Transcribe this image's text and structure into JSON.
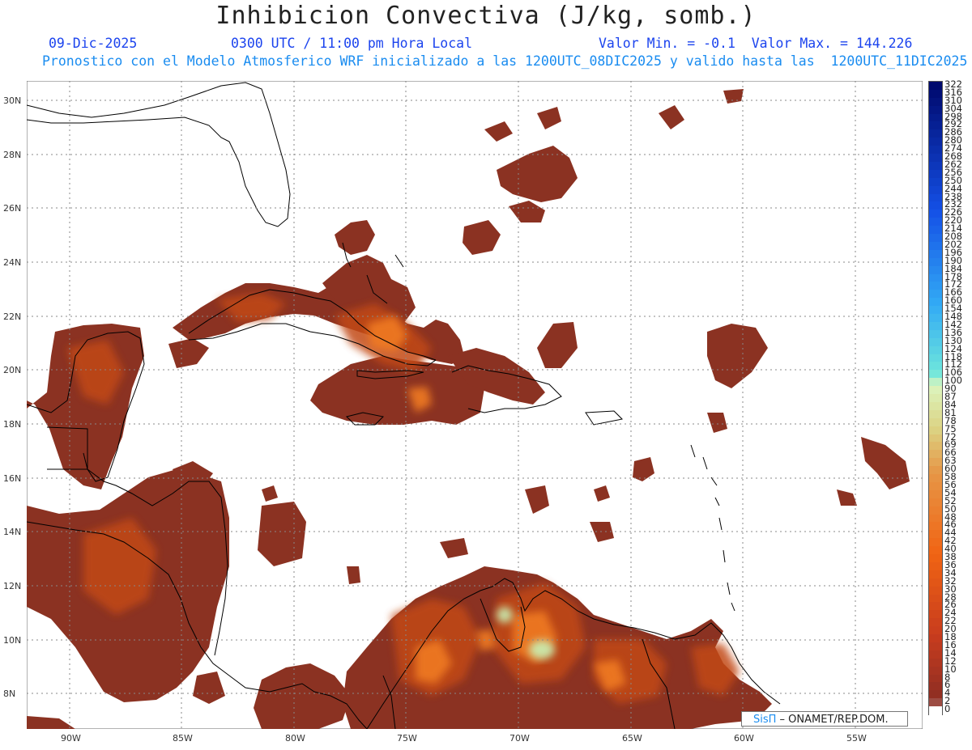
{
  "header": {
    "title": "Inhibicion Convectiva (J/kg, somb.)",
    "date": "09-Dic-2025",
    "time": "0300 UTC / 11:00 pm Hora Local",
    "value_range": "Valor Min. = -0.1  Valor Max. = 144.226",
    "model_info": "Pronostico con el Modelo Atmosferico WRF inicializado a las 1200UTC_08DIC2025 y valido hasta las  1200UTC_11DIC2025"
  },
  "map": {
    "lat_labels": [
      "30N",
      "28N",
      "26N",
      "24N",
      "22N",
      "20N",
      "18N",
      "16N",
      "14N",
      "12N",
      "10N",
      "8N"
    ],
    "lon_labels": [
      "90W",
      "85W",
      "80W",
      "75W",
      "70W",
      "65W",
      "60W",
      "55W"
    ],
    "colors": {
      "cin_low": "#8b3222",
      "cin_mid": "#c24a18",
      "cin_high": "#f07a22",
      "cin_peak": "#c8f0b4",
      "coast": "#000000",
      "grid": "#888888"
    }
  },
  "colorbar": {
    "labels": [
      "322",
      "316",
      "310",
      "304",
      "298",
      "292",
      "286",
      "280",
      "274",
      "268",
      "262",
      "256",
      "250",
      "244",
      "238",
      "232",
      "226",
      "220",
      "214",
      "208",
      "202",
      "196",
      "190",
      "184",
      "178",
      "172",
      "166",
      "160",
      "154",
      "148",
      "142",
      "136",
      "130",
      "124",
      "118",
      "112",
      "106",
      "100",
      "90",
      "87",
      "84",
      "81",
      "78",
      "75",
      "72",
      "69",
      "66",
      "63",
      "60",
      "58",
      "56",
      "54",
      "52",
      "50",
      "48",
      "46",
      "44",
      "42",
      "40",
      "38",
      "36",
      "34",
      "32",
      "30",
      "28",
      "26",
      "24",
      "22",
      "20",
      "18",
      "16",
      "14",
      "12",
      "10",
      "8",
      "6",
      "4",
      "2",
      "0"
    ]
  },
  "credit": {
    "brand": "SisΠ",
    "text": " – ONAMET/REP.DOM."
  }
}
